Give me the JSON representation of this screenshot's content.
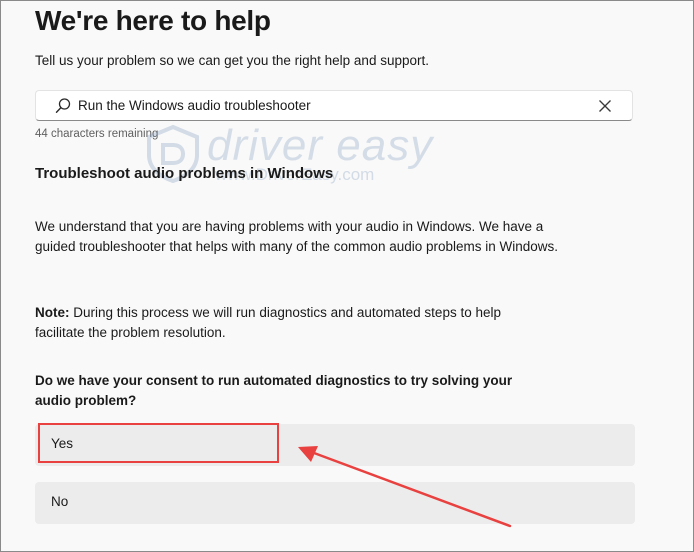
{
  "header": {
    "title": "We're here to help",
    "subtitle": "Tell us your problem so we can get you the right help and support."
  },
  "search": {
    "value": "Run the Windows audio troubleshooter",
    "chars_remaining": "44 characters remaining"
  },
  "content": {
    "section_title": "Troubleshoot audio problems in Windows",
    "paragraph_1": "We understand that you are having problems with your audio in Windows. We have a guided troubleshooter that helps with many of the common audio problems in Windows.",
    "note_label": "Note:",
    "note_text": " During this process we will run diagnostics and automated steps to help facilitate the problem resolution.",
    "question": "Do we have your consent to run automated diagnostics to try solving your audio problem?"
  },
  "options": [
    {
      "label": "Yes"
    },
    {
      "label": "No"
    }
  ],
  "watermark": {
    "brand": "driver easy",
    "url": "www.DriverEasy.com"
  },
  "colors": {
    "annotation": "#e8413f",
    "option_bg": "#ececec",
    "page_bg": "#f9f9f9"
  },
  "icons": {
    "search": "search-icon",
    "clear": "close-icon"
  }
}
